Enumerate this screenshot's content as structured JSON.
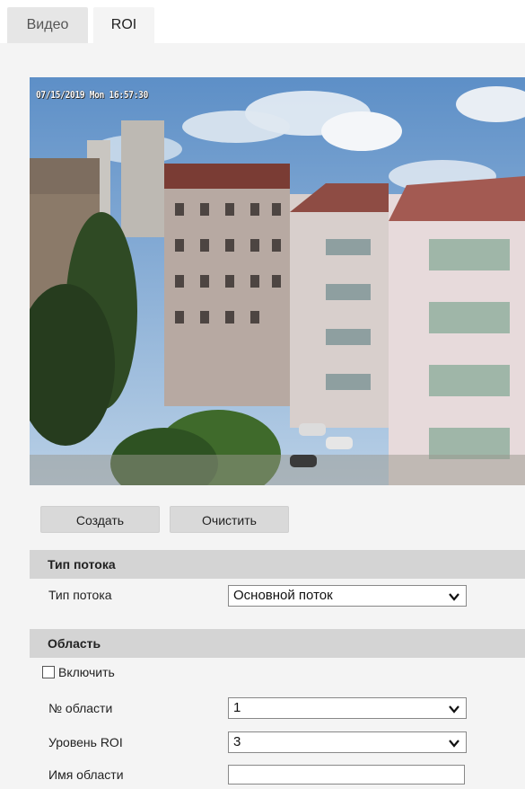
{
  "tabs": [
    {
      "label": "Видео",
      "active": false
    },
    {
      "label": "ROI",
      "active": true
    }
  ],
  "preview": {
    "osd_text": "07/15/2019 Mon 16:57:30"
  },
  "buttons": {
    "create": "Создать",
    "clear": "Очистить"
  },
  "stream_section": {
    "title": "Тип потока",
    "stream_type_label": "Тип потока",
    "stream_type_value": "Основной поток"
  },
  "area_section": {
    "title": "Область",
    "enable_label": "Включить",
    "enable_checked": false,
    "area_no_label": "№ области",
    "area_no_value": "1",
    "roi_level_label": "Уровень ROI",
    "roi_level_value": "3",
    "area_name_label": "Имя области",
    "area_name_value": ""
  },
  "icons": {
    "dropdown": "chevron-down-icon"
  },
  "colors": {
    "panel_bg": "#f4f4f4",
    "section_header_bg": "#d4d4d4",
    "button_bg": "#d9d9d9"
  }
}
